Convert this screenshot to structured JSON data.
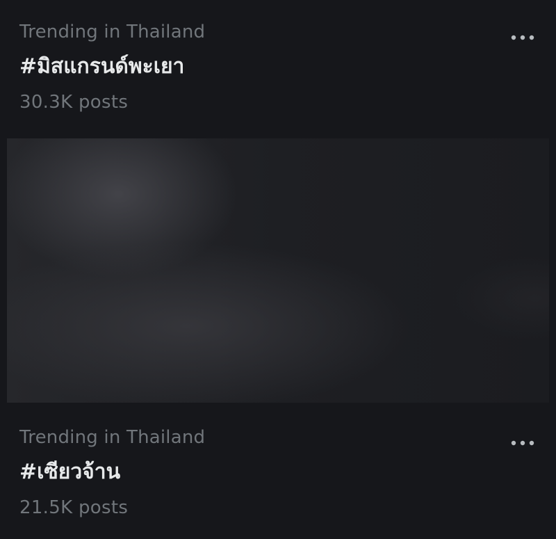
{
  "trends": [
    {
      "context": "Trending in Thailand",
      "hashtag": "#มิสแกรนด์พะเยา",
      "posts": "30.3K posts",
      "more_icon": "more-horizontal-icon"
    },
    {
      "context": "Trending in Thailand",
      "hashtag": "#เซียวจ้าน",
      "posts": "21.5K posts",
      "more_icon": "more-horizontal-icon"
    }
  ],
  "media": {
    "description_icon": "blurred-image"
  },
  "colors": {
    "background": "#16171b",
    "primary_text": "#e7e9ea",
    "secondary_text": "#71767b"
  }
}
